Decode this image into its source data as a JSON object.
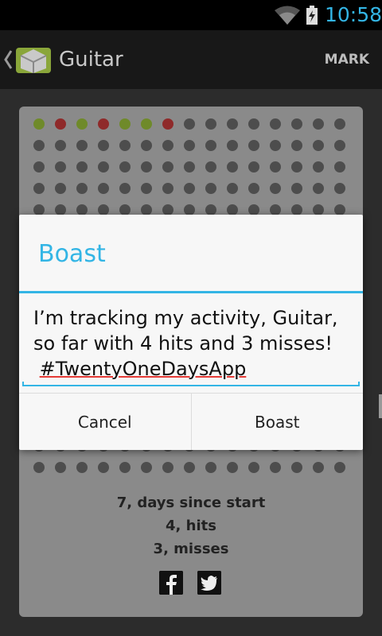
{
  "status_bar": {
    "time": "10:58",
    "icons": [
      "wifi-icon",
      "battery-charging-icon"
    ],
    "accent_color": "#33b5e5"
  },
  "action_bar": {
    "title": "Guitar",
    "mark_label": "MARK",
    "icons": [
      "back-chevron-icon",
      "android-app-icon"
    ]
  },
  "activity": {
    "day_states": [
      "hit",
      "miss",
      "hit",
      "miss",
      "hit",
      "hit",
      "miss"
    ],
    "colors": {
      "hit": "#6f8a2a",
      "miss": "#8f2a2a",
      "pending": "#4d4d4d"
    },
    "stats": [
      "7, days since start",
      "4, hits",
      "3, misses"
    ],
    "share_icons": [
      "facebook-icon",
      "twitter-icon"
    ]
  },
  "dialog": {
    "title": "Boast",
    "message_lines": [
      "I’m tracking my activity, Guitar,",
      "so far with 4 hits and 3 misses!"
    ],
    "hashtag": "#TwentyOneDaysApp",
    "cancel_label": "Cancel",
    "confirm_label": "Boast"
  }
}
